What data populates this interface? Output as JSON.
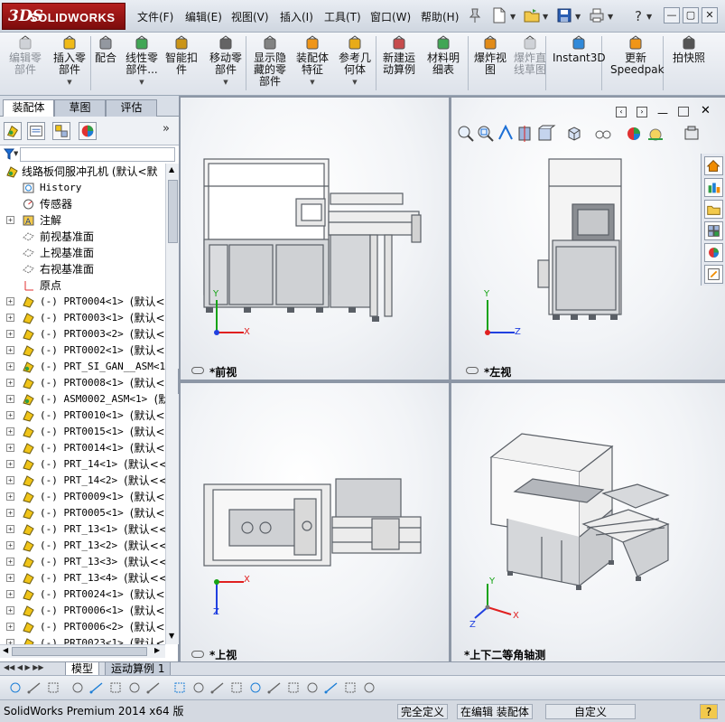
{
  "app": {
    "logo_prefix": "3DS",
    "logo_name": "SOLIDWORKS"
  },
  "menu": [
    "文件(F)",
    "编辑(E)",
    "视图(V)",
    "插入(I)",
    "工具(T)",
    "窗口(W)",
    "帮助(H)"
  ],
  "window_buttons": [
    "—",
    "▢",
    "✕"
  ],
  "commands": [
    {
      "label": "编辑零\n部件",
      "icon": "edit-component-icon",
      "disabled": true,
      "dropdown": false
    },
    {
      "label": "插入零\n部件",
      "icon": "insert-component-icon",
      "disabled": false,
      "dropdown": true
    },
    {
      "label": "配合",
      "icon": "mate-icon",
      "disabled": false,
      "dropdown": false
    },
    {
      "label": "线性零\n部件...",
      "icon": "linear-pattern-icon",
      "disabled": false,
      "dropdown": true
    },
    {
      "label": "智能扣\n件",
      "icon": "smart-fastener-icon",
      "disabled": false,
      "dropdown": false
    },
    {
      "label": "移动零\n部件",
      "icon": "move-component-icon",
      "disabled": false,
      "dropdown": true
    },
    {
      "label": "显示隐\n藏的零\n部件",
      "icon": "show-hidden-icon",
      "disabled": false,
      "dropdown": false
    },
    {
      "label": "装配体\n特征",
      "icon": "assembly-feature-icon",
      "disabled": false,
      "dropdown": true
    },
    {
      "label": "参考几\n何体",
      "icon": "reference-geometry-icon",
      "disabled": false,
      "dropdown": true
    },
    {
      "label": "新建运\n动算例",
      "icon": "motion-study-icon",
      "disabled": false,
      "dropdown": false
    },
    {
      "label": "材料明\n细表",
      "icon": "bom-icon",
      "disabled": false,
      "dropdown": false
    },
    {
      "label": "爆炸视\n图",
      "icon": "exploded-view-icon",
      "disabled": false,
      "dropdown": false
    },
    {
      "label": "爆炸直\n线草图",
      "icon": "explode-line-icon",
      "disabled": true,
      "dropdown": false
    },
    {
      "label": "Instant3D",
      "icon": "instant3d-icon",
      "disabled": false,
      "dropdown": false
    },
    {
      "label": "更新\nSpeedpak",
      "icon": "speedpak-icon",
      "disabled": false,
      "dropdown": false
    },
    {
      "label": "拍快照",
      "icon": "snapshot-icon",
      "disabled": false,
      "dropdown": false
    }
  ],
  "left_tabs": [
    "装配体",
    "草图",
    "评估"
  ],
  "tree": {
    "root": "线路板伺服冲孔机 (默认<默",
    "fixed_items": [
      {
        "label": "History",
        "icon": "history-icon",
        "expand": false
      },
      {
        "label": "传感器",
        "icon": "sensor-icon",
        "expand": false
      },
      {
        "label": "注解",
        "icon": "annotation-icon",
        "expand": true
      },
      {
        "label": "前视基准面",
        "icon": "plane-icon",
        "expand": false
      },
      {
        "label": "上视基准面",
        "icon": "plane-icon",
        "expand": false
      },
      {
        "label": "右视基准面",
        "icon": "plane-icon",
        "expand": false
      },
      {
        "label": "原点",
        "icon": "origin-icon",
        "expand": false
      }
    ],
    "components": [
      {
        "name": "(-) PRT0004<1>",
        "config": "(默认<<",
        "kind": "part"
      },
      {
        "name": "(-) PRT0003<1>",
        "config": "(默认<<",
        "kind": "part"
      },
      {
        "name": "(-) PRT0003<2>",
        "config": "(默认<<",
        "kind": "part"
      },
      {
        "name": "(-) PRT0002<1>",
        "config": "(默认<<",
        "kind": "part"
      },
      {
        "name": "(-) PRT_SI_GAN__ASM<1>",
        "config": "",
        "kind": "assembly"
      },
      {
        "name": "(-) PRT0008<1>",
        "config": "(默认<<",
        "kind": "part"
      },
      {
        "name": "(-) ASM0002_ASM<1>",
        "config": "(默认",
        "kind": "assembly"
      },
      {
        "name": "(-) PRT0010<1>",
        "config": "(默认<<",
        "kind": "part"
      },
      {
        "name": "(-) PRT0015<1>",
        "config": "(默认<<",
        "kind": "part"
      },
      {
        "name": "(-) PRT0014<1>",
        "config": "(默认<<",
        "kind": "part"
      },
      {
        "name": "(-) PRT_14<1>",
        "config": "(默认<<",
        "kind": "part"
      },
      {
        "name": "(-) PRT_14<2>",
        "config": "(默认<<",
        "kind": "part"
      },
      {
        "name": "(-) PRT0009<1>",
        "config": "(默认<<",
        "kind": "part"
      },
      {
        "name": "(-) PRT0005<1>",
        "config": "(默认<<",
        "kind": "part"
      },
      {
        "name": "(-) PRT_13<1>",
        "config": "(默认<<",
        "kind": "part"
      },
      {
        "name": "(-) PRT_13<2>",
        "config": "(默认<<",
        "kind": "part"
      },
      {
        "name": "(-) PRT_13<3>",
        "config": "(默认<<",
        "kind": "part"
      },
      {
        "name": "(-) PRT_13<4>",
        "config": "(默认<<",
        "kind": "part"
      },
      {
        "name": "(-) PRT0024<1>",
        "config": "(默认<<",
        "kind": "part"
      },
      {
        "name": "(-) PRT0006<1>",
        "config": "(默认<<",
        "kind": "part"
      },
      {
        "name": "(-) PRT0006<2>",
        "config": "(默认<<",
        "kind": "part"
      },
      {
        "name": "(-) PRT0023<1>",
        "config": "(默认<<",
        "kind": "part"
      }
    ]
  },
  "viewports": {
    "front": "*前视",
    "left": "*左视",
    "top": "*上视",
    "iso": "*上下二等角轴测"
  },
  "axes": {
    "x": "X",
    "y": "Y",
    "z": "Z"
  },
  "bottom_tabs": [
    "模型",
    "运动算例 1"
  ],
  "status": {
    "version": "SolidWorks Premium 2014 x64 版",
    "definition": "完全定义",
    "editing": "在编辑 装配体",
    "units": "自定义",
    "help": "?"
  },
  "colors": {
    "frame": "#5a5f66",
    "panel": "#d9dbde",
    "axis_x": "#e02020",
    "axis_y": "#16a316",
    "axis_z": "#2040e0",
    "brand": "#a01818"
  }
}
